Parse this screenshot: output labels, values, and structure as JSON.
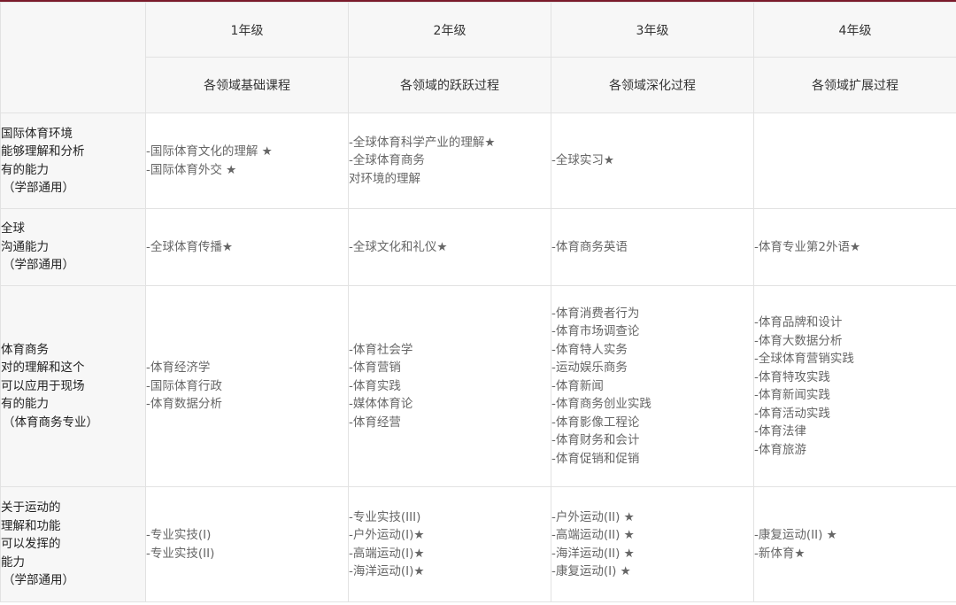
{
  "grades": [
    "1年级",
    "2年级",
    "3年级",
    "4年级"
  ],
  "stages": [
    "各领域基础课程",
    "各领域的跃跃过程",
    "各领域深化过程",
    "各领域扩展过程"
  ],
  "rows": [
    {
      "head": [
        "国际体育环境",
        "能够理解和分析",
        "有的能力",
        "（学部通用）"
      ],
      "cells": [
        [
          "-国际体育文化的理解 ★",
          "-国际体育外交 ★"
        ],
        [
          "-全球体育科学产业的理解★",
          "-全球体育商务",
          "对环境的理解"
        ],
        [
          "-全球实习★"
        ],
        []
      ]
    },
    {
      "head": [
        "全球",
        "沟通能力",
        "（学部通用）"
      ],
      "cells": [
        [
          "-全球体育传播★"
        ],
        [
          "-全球文化和礼仪★"
        ],
        [
          "-体育商务英语"
        ],
        [
          "-体育专业第2外语★"
        ]
      ]
    },
    {
      "head": [
        "体育商务",
        "对的理解和这个",
        "可以应用于现场",
        "有的能力",
        "（体育商务专业）"
      ],
      "cells": [
        [
          "-体育经济学",
          "-国际体育行政",
          "-体育数据分析"
        ],
        [
          "-体育社会学",
          "-体育营销",
          "-体育实践",
          "-媒体体育论",
          "-体育经营"
        ],
        [
          "-体育消费者行为",
          "-体育市场调查论",
          "-体育特人实务",
          "-运动娱乐商务",
          "-体育新闻",
          "-体育商务创业实践",
          "-体育影像工程论",
          "-体育财务和会计",
          "-体育促销和促销"
        ],
        [
          "-体育品牌和设计",
          "-体育大数据分析",
          "-全球体育营销实践",
          "-体育特攻实践",
          "-体育新闻实践",
          "-体育活动实践",
          "-体育法律",
          "-体育旅游"
        ]
      ]
    },
    {
      "head": [
        "关于运动的",
        "理解和功能",
        "可以发挥的",
        "能力",
        "（学部通用）"
      ],
      "cells": [
        [
          "-专业实技(I)",
          "-专业实技(II)"
        ],
        [
          "-专业实技(III)",
          "-户外运动(I)★",
          "-高端运动(I)★",
          "-海洋运动(I)★"
        ],
        [
          "-户外运动(II) ★",
          "-高端运动(II) ★",
          "-海洋运动(II) ★",
          "-康复运动(I) ★"
        ],
        [
          "-康复运动(II) ★",
          "-新体育★"
        ]
      ]
    }
  ]
}
